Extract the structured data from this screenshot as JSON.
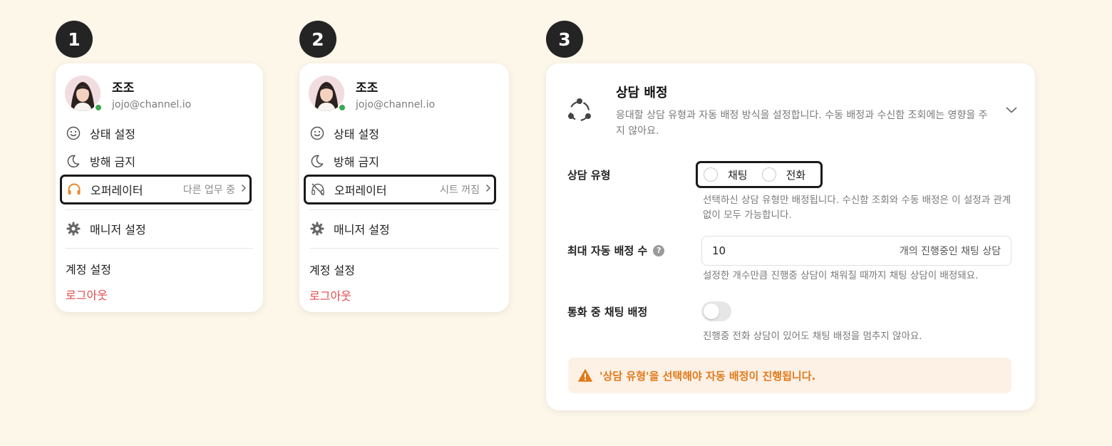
{
  "steps": [
    "1",
    "2",
    "3"
  ],
  "profile_cards": [
    {
      "name": "조조",
      "email": "jojo@channel.io",
      "menu": {
        "status_setting": "상태 설정",
        "do_not_disturb": "방해 금지",
        "operator_label": "오퍼레이터",
        "operator_status": "다른 업무 중",
        "manager_settings": "매니저 설정",
        "account_settings": "계정 설정",
        "logout": "로그아웃"
      },
      "operator_icon": "headset-icon",
      "operator_icon_color": "#e8892b"
    },
    {
      "name": "조조",
      "email": "jojo@channel.io",
      "menu": {
        "status_setting": "상태 설정",
        "do_not_disturb": "방해 금지",
        "operator_label": "오퍼레이터",
        "operator_status": "시트 꺼짐",
        "manager_settings": "매니저 설정",
        "account_settings": "계정 설정",
        "logout": "로그아웃"
      },
      "operator_icon": "headset-off-icon",
      "operator_icon_color": "#666666"
    }
  ],
  "assignment_settings": {
    "title": "상담 배정",
    "description": "응대할 상담 유형과 자동 배정 방식을 설정합니다. 수동 배정과 수신함 조회에는 영향을 주지 않아요.",
    "consult_type": {
      "label": "상담 유형",
      "options": [
        "채팅",
        "전화"
      ],
      "help": "선택하신 상담 유형만 배정됩니다. 수신함 조회와 수동 배정은 이 설정과 관계없이 모두 가능합니다."
    },
    "max_auto_assign": {
      "label": "최대 자동 배정 수",
      "value": "10",
      "unit": "개의 진행중인 채팅 상담",
      "help": "설정한 개수만큼 진행중 상담이 채워질 때까지 채팅 상담이 배정돼요."
    },
    "chat_during_call": {
      "label": "통화 중 채팅 배정",
      "enabled": false,
      "help": "진행중 전화 상담이 있어도 채팅 배정을 멈추지 않아요."
    },
    "warning": "'상담 유형'을 선택해야 자동 배정이 진행됩니다.",
    "warning_color": "#e07a1a"
  }
}
